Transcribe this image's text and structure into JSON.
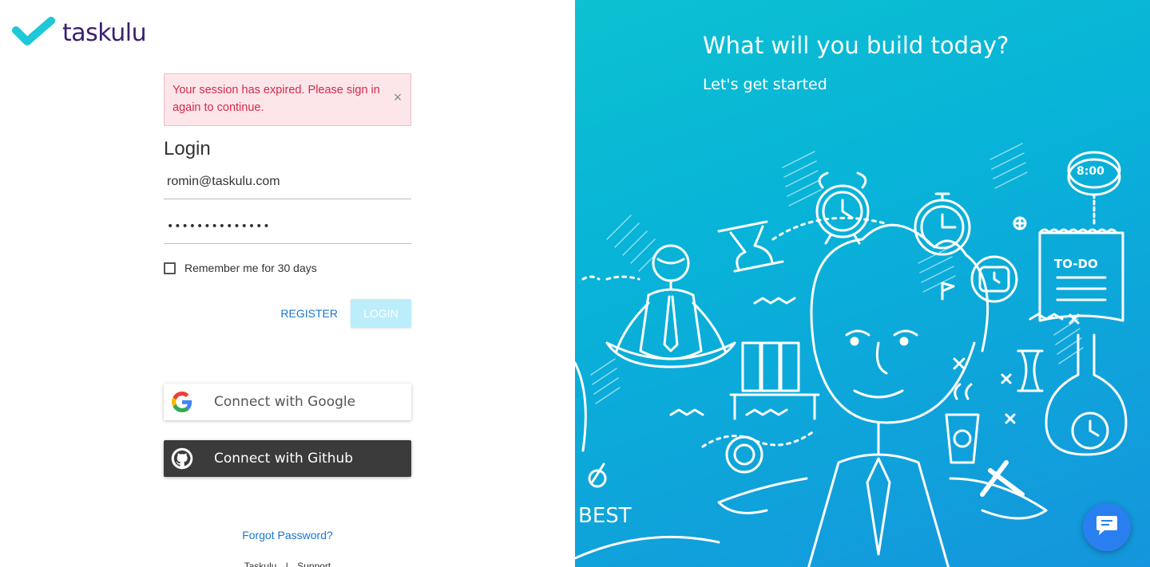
{
  "brand": {
    "name": "taskulu"
  },
  "alert": {
    "message": "Your session has expired. Please sign in again to continue.",
    "close_glyph": "×"
  },
  "login": {
    "title": "Login",
    "email_value": "romin@taskulu.com",
    "password_value": "••••••••••••••",
    "remember_label": "Remember me for 30 days",
    "register_label": "REGISTER",
    "login_label": "LOGIN"
  },
  "social": {
    "google_label": "Connect with Google",
    "github_label": "Connect with Github"
  },
  "links": {
    "forgot": "Forgot Password?",
    "footer_left": "Taskulu",
    "footer_sep": "|",
    "footer_right": "Support"
  },
  "hero": {
    "title": "What will you build today?",
    "subtitle": "Let's get started",
    "clock_label": "8:00",
    "todo_label": "TO-DO",
    "best_label": "BEST"
  },
  "colors": {
    "brand_cyan": "#0cc1d1",
    "brand_purple": "#3a1f6e",
    "link_blue": "#1976d2",
    "alert_red": "#d22a4b",
    "login_disabled": "#bbeefa",
    "github_dark": "#3b3b3b",
    "chat_blue": "#2a7ff0"
  },
  "icons": {
    "logo": "checkmark-logo-icon",
    "google": "google-g-icon",
    "github": "github-octocat-icon",
    "chat": "chat-bubble-icon"
  }
}
